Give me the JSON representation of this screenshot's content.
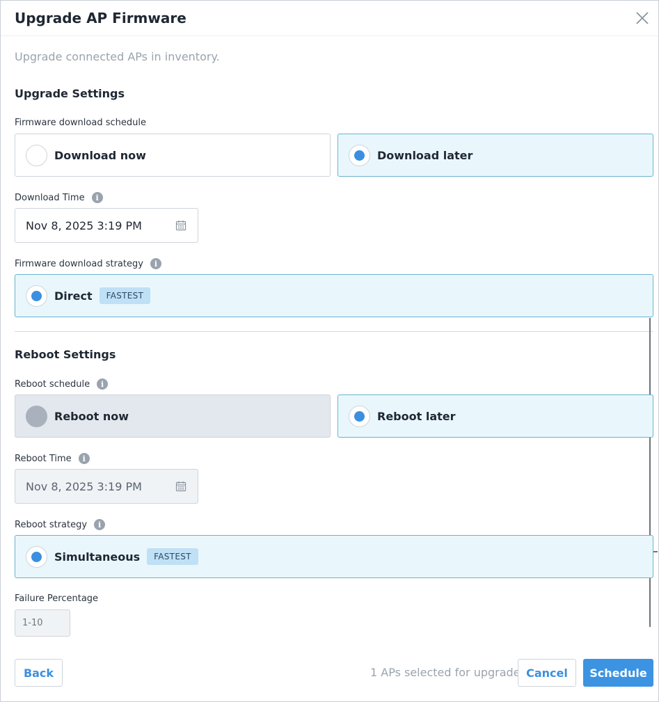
{
  "dialog": {
    "title": "Upgrade AP Firmware",
    "subtitle": "Upgrade connected APs in inventory."
  },
  "upgrade_settings": {
    "title": "Upgrade Settings",
    "schedule_label": "Firmware download schedule",
    "options": [
      {
        "label": "Download now",
        "selected": false
      },
      {
        "label": "Download later",
        "selected": true
      }
    ],
    "download_time_label": "Download Time",
    "download_time_value": "Nov 8, 2025 3:19 PM",
    "strategy_label": "Firmware download strategy",
    "strategy_option": {
      "label": "Direct",
      "badge": "FASTEST",
      "selected": true
    }
  },
  "reboot_settings": {
    "title": "Reboot Settings",
    "schedule_label": "Reboot schedule",
    "options": [
      {
        "label": "Reboot now",
        "selected": false,
        "disabled": true
      },
      {
        "label": "Reboot later",
        "selected": true
      }
    ],
    "reboot_time_label": "Reboot Time",
    "reboot_time_value": "Nov 8, 2025 3:19 PM",
    "strategy_label": "Reboot strategy",
    "strategy_option": {
      "label": "Simultaneous",
      "badge": "FASTEST",
      "selected": true
    },
    "failure_label": "Failure Percentage",
    "failure_placeholder": "1-10"
  },
  "footer": {
    "back_label": "Back",
    "status_text": "1 APs selected for upgrade",
    "cancel_label": "Cancel",
    "schedule_label": "Schedule"
  },
  "colors": {
    "accent": "#3b93e2",
    "selected_bg": "#e9f7fd",
    "badge_bg": "#bfe0f5"
  }
}
